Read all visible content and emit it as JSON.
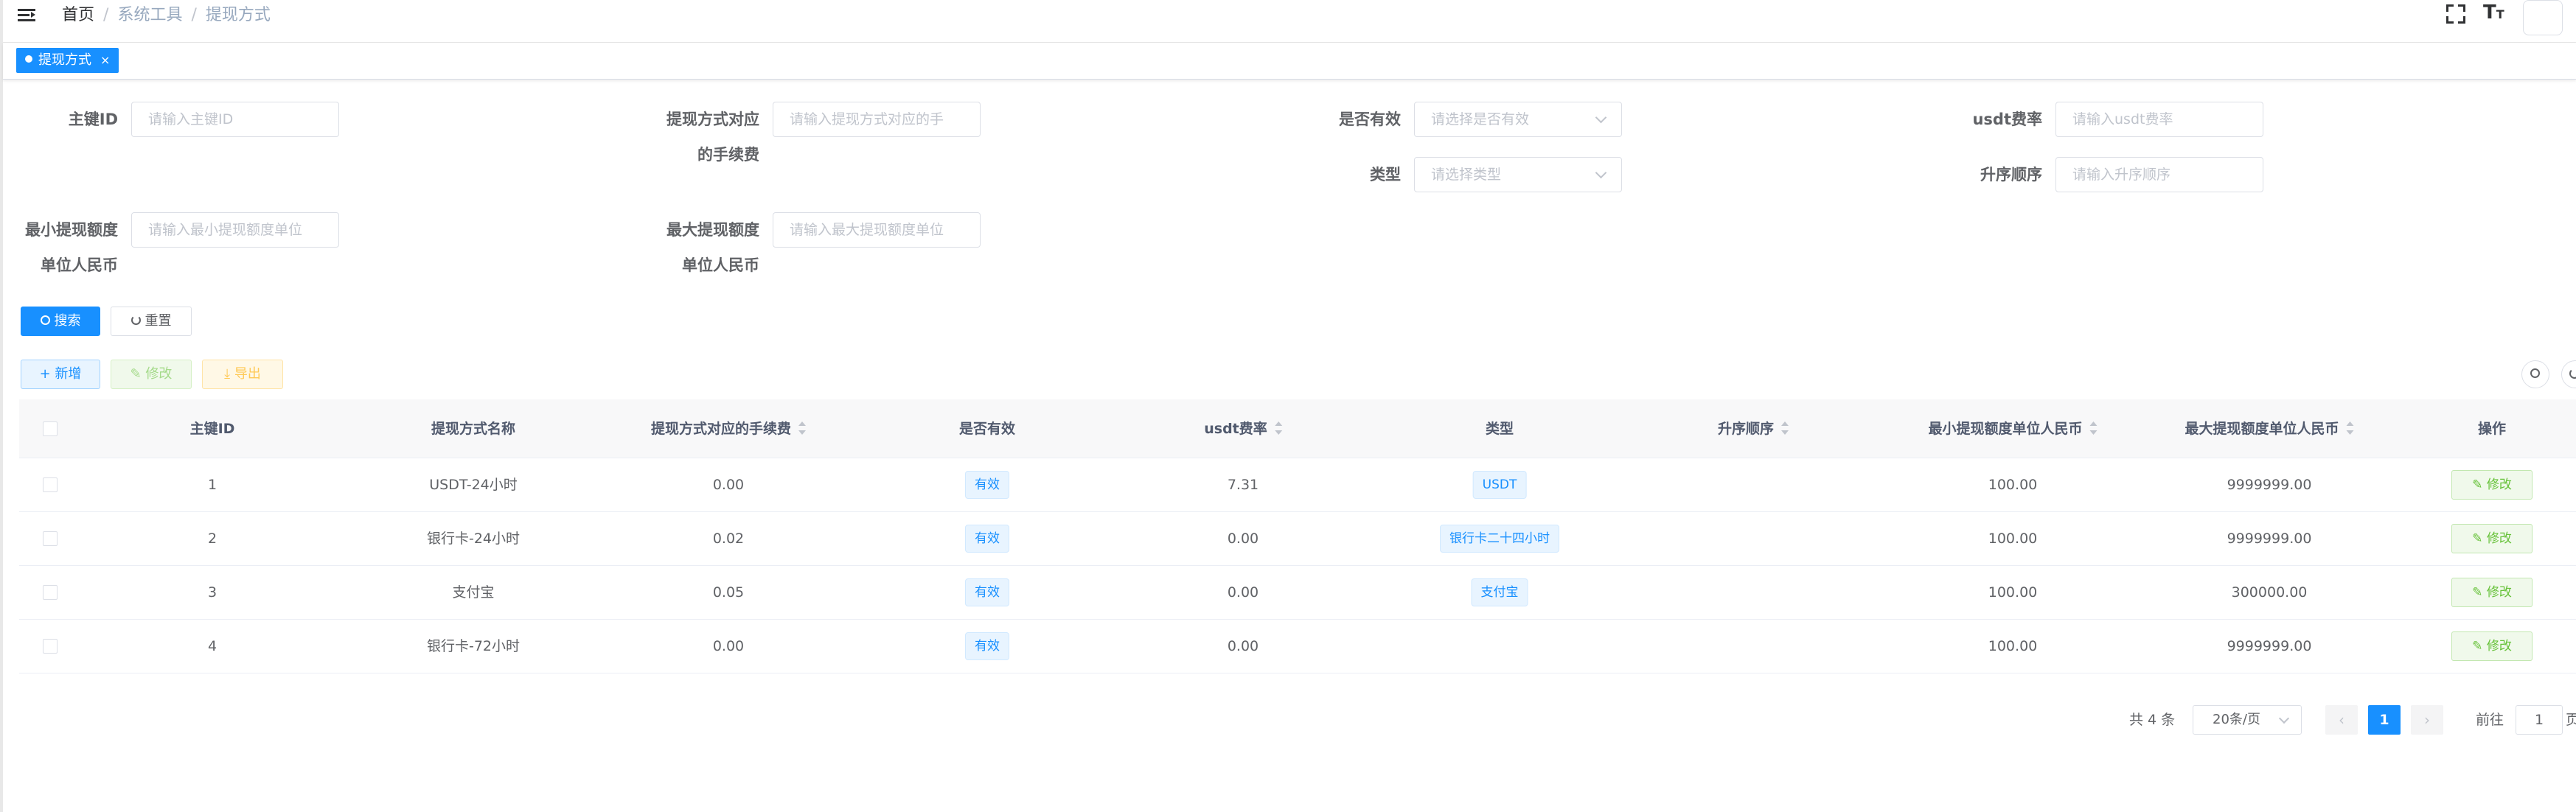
{
  "breadcrumb": [
    "首页",
    "系统工具",
    "提现方式"
  ],
  "tags": {
    "active": "提现方式",
    "close": "×"
  },
  "form": {
    "id_label": "主键ID",
    "id_placeholder": "请输入主键ID",
    "fee_label_1": "提现方式对应",
    "fee_label_2": "的手续费",
    "fee_placeholder": "请输入提现方式对应的手",
    "valid_label": "是否有效",
    "valid_placeholder": "请选择是否有效",
    "usdt_label": "usdt费率",
    "usdt_placeholder": "请输入usdt费率",
    "type_label": "类型",
    "type_placeholder": "请选择类型",
    "sort_label": "升序顺序",
    "sort_placeholder": "请输入升序顺序",
    "min_label_1": "最小提现额度",
    "min_label_2": "单位人民币",
    "min_placeholder": "请输入最小提现额度单位",
    "max_label_1": "最大提现额度",
    "max_label_2": "单位人民币",
    "max_placeholder": "请输入最大提现额度单位",
    "search_btn": "搜索",
    "reset_btn": "重置"
  },
  "toolbar": {
    "add": "新增",
    "edit": "修改",
    "export": "导出"
  },
  "table": {
    "headers": [
      "主键ID",
      "提现方式名称",
      "提现方式对应的手续费",
      "是否有效",
      "usdt费率",
      "类型",
      "升序顺序",
      "最小提现额度单位人民币",
      "最大提现额度单位人民币",
      "操作"
    ],
    "rows": [
      {
        "id": "1",
        "name": "USDT-24小时",
        "fee": "0.00",
        "valid": "有效",
        "usdt": "7.31",
        "type": "USDT",
        "sort": "",
        "min": "100.00",
        "max": "9999999.00",
        "action": "修改"
      },
      {
        "id": "2",
        "name": "银行卡-24小时",
        "fee": "0.02",
        "valid": "有效",
        "usdt": "0.00",
        "type": "银行卡二十四小时",
        "sort": "",
        "min": "100.00",
        "max": "9999999.00",
        "action": "修改"
      },
      {
        "id": "3",
        "name": "支付宝",
        "fee": "0.05",
        "valid": "有效",
        "usdt": "0.00",
        "type": "支付宝",
        "sort": "",
        "min": "100.00",
        "max": "300000.00",
        "action": "修改"
      },
      {
        "id": "4",
        "name": "银行卡-72小时",
        "fee": "0.00",
        "valid": "有效",
        "usdt": "0.00",
        "type": "",
        "sort": "",
        "min": "100.00",
        "max": "9999999.00",
        "action": "修改"
      }
    ]
  },
  "pagination": {
    "total": "共 4 条",
    "page_size": "20条/页",
    "current": "1",
    "goto_label": "前往",
    "goto_value": "1",
    "page_suffix": "页",
    "prev": "‹",
    "next": "›"
  },
  "colors": {
    "primary": "#1890ff",
    "success": "#67c23a",
    "warning": "#ffba00"
  }
}
